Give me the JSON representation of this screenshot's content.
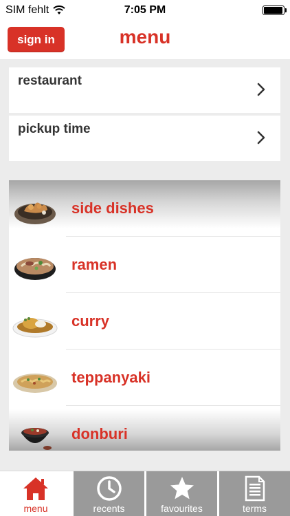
{
  "status_bar": {
    "carrier": "SIM fehlt",
    "time": "7:05 PM",
    "battery_level": 0.95
  },
  "nav": {
    "sign_in_label": "sign in",
    "title": "menu"
  },
  "selectors": [
    {
      "label": "restaurant",
      "icon": "chevron-right-icon"
    },
    {
      "label": "pickup time",
      "icon": "chevron-right-icon"
    }
  ],
  "categories": [
    {
      "name": "side dishes",
      "icon": "side-dishes-thumb"
    },
    {
      "name": "ramen",
      "icon": "ramen-thumb"
    },
    {
      "name": "curry",
      "icon": "curry-thumb"
    },
    {
      "name": "teppanyaki",
      "icon": "teppanyaki-thumb"
    },
    {
      "name": "donburi",
      "icon": "donburi-thumb"
    }
  ],
  "tabs": [
    {
      "label": "menu",
      "icon": "home-icon",
      "active": true
    },
    {
      "label": "recents",
      "icon": "clock-icon",
      "active": false
    },
    {
      "label": "favourites",
      "icon": "star-icon",
      "active": false
    },
    {
      "label": "terms",
      "icon": "document-icon",
      "active": false
    }
  ],
  "colors": {
    "accent": "#d83227",
    "background": "#ececec",
    "tab_inactive": "#9a9a9a"
  }
}
